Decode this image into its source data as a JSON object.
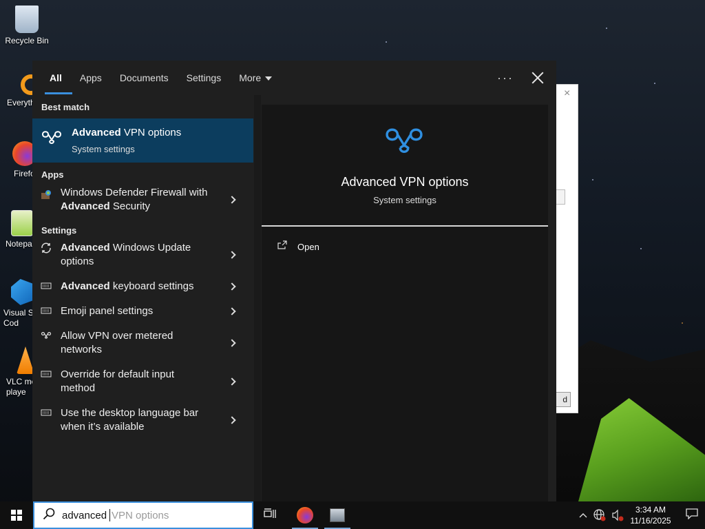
{
  "desktop": {
    "icons": [
      {
        "label": "Recycle Bin"
      },
      {
        "label": "Everyth"
      },
      {
        "label": "Firefo"
      },
      {
        "label": "Notepa"
      },
      {
        "label": "Visual St\nCod"
      },
      {
        "label": "VLC me\nplaye"
      }
    ],
    "background_window": {
      "button_label": "d"
    }
  },
  "search_panel": {
    "tabs": [
      {
        "label": "All",
        "active": true
      },
      {
        "label": "Apps"
      },
      {
        "label": "Documents"
      },
      {
        "label": "Settings"
      },
      {
        "label": "More"
      }
    ],
    "more_options_icon": "ellipsis-icon",
    "close_icon": "close-icon",
    "best_match_header": "Best match",
    "best_match": {
      "title_bold": "Advanced",
      "title_rest": " VPN options",
      "subtitle": "System settings",
      "icon": "vpn-icon"
    },
    "apps_header": "Apps",
    "apps": [
      {
        "line1": "Windows Defender Firewall with",
        "line2_bold": "Advanced",
        "line2_rest": " Security",
        "icon": "firewall-icon"
      }
    ],
    "settings_header": "Settings",
    "settings": [
      {
        "bold": "Advanced",
        "rest": " Windows Update",
        "line2": "options",
        "icon": "sync-icon"
      },
      {
        "bold": "Advanced",
        "rest": " keyboard settings",
        "line2": "",
        "icon": "keyboard-icon"
      },
      {
        "bold": "",
        "rest": "Emoji panel settings",
        "line2": "",
        "icon": "keyboard-icon"
      },
      {
        "bold": "",
        "rest": "Allow VPN over metered",
        "line2": "networks",
        "icon": "vpn-icon"
      },
      {
        "bold": "",
        "rest": "Override for default input",
        "line2": "method",
        "icon": "keyboard-icon"
      },
      {
        "bold": "",
        "rest": "Use the desktop language bar",
        "line2": "when it’s available",
        "icon": "keyboard-icon"
      }
    ],
    "detail": {
      "title": "Advanced VPN options",
      "subtitle": "System settings",
      "open_label": "Open"
    }
  },
  "taskbar": {
    "search_value": "advanced",
    "search_suggestion": "VPN options",
    "time": "3:34 AM",
    "date": "11/16/2025"
  }
}
